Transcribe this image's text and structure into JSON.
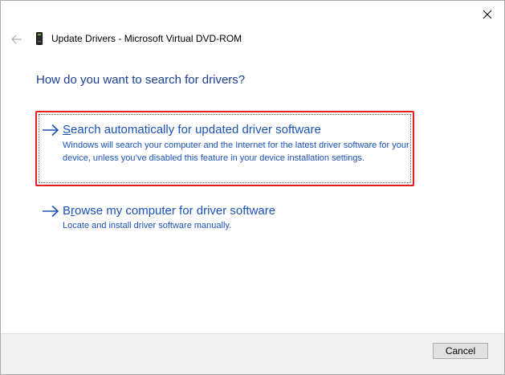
{
  "window": {
    "close_glyph": "✕"
  },
  "header": {
    "back_icon": "back-arrow-icon",
    "device_icon": "dvd-drive-icon",
    "title": "Update Drivers - Microsoft Virtual DVD-ROM"
  },
  "main": {
    "question": "How do you want to search for drivers?",
    "options": [
      {
        "title_accel": "S",
        "title_rest": "earch automatically for updated driver software",
        "description": "Windows will search your computer and the Internet for the latest driver software for your device, unless you’ve disabled this feature in your device installation settings.",
        "selected": true
      },
      {
        "title_accel": "r",
        "title_pre": "B",
        "title_rest": "owse my computer for driver software",
        "description": "Locate and install driver software manually.",
        "selected": false
      }
    ]
  },
  "footer": {
    "cancel_label": "Cancel"
  },
  "colors": {
    "link_blue": "#1a52b8",
    "heading_blue": "#1c3f94",
    "highlight_red": "#e3211e"
  }
}
